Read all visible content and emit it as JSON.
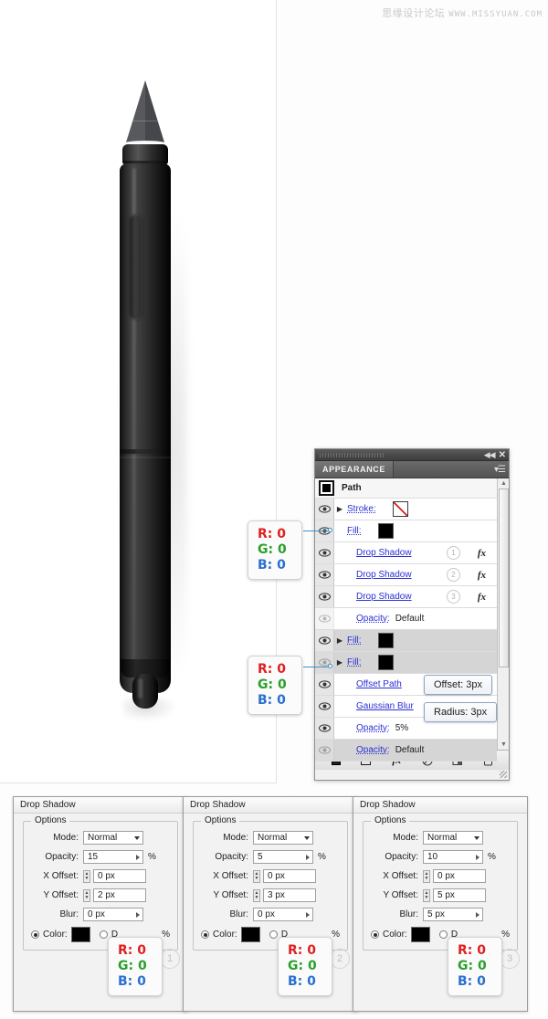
{
  "watermark": {
    "cn": "思缘设计论坛",
    "url": "WWW.MISSYUAN.COM"
  },
  "appearance_panel": {
    "tab_label": "APPEARANCE",
    "collapse_icon": "◀◀",
    "close_icon": "✕",
    "menu_icon": "panel-menu-icon",
    "object_title": "Path",
    "rows": [
      {
        "id": "stroke",
        "label": "Stroke:",
        "value": "",
        "swatch": "none",
        "arrow": true,
        "indent": false,
        "shaded": false,
        "eye": "on",
        "badge": "",
        "fx": false
      },
      {
        "id": "fill-1",
        "label": "Fill:",
        "value": "",
        "swatch": "black",
        "arrow": false,
        "indent": false,
        "shaded": false,
        "eye": "on",
        "badge": "",
        "fx": false
      },
      {
        "id": "drop-shadow-1",
        "label": "Drop Shadow",
        "value": "",
        "swatch": "",
        "arrow": false,
        "indent": true,
        "shaded": false,
        "eye": "on",
        "badge": "1",
        "fx": true
      },
      {
        "id": "drop-shadow-2",
        "label": "Drop Shadow",
        "value": "",
        "swatch": "",
        "arrow": false,
        "indent": true,
        "shaded": false,
        "eye": "on",
        "badge": "2",
        "fx": true
      },
      {
        "id": "drop-shadow-3",
        "label": "Drop Shadow",
        "value": "",
        "swatch": "",
        "arrow": false,
        "indent": true,
        "shaded": false,
        "eye": "on",
        "badge": "3",
        "fx": true
      },
      {
        "id": "opacity-1",
        "label": "Opacity:",
        "value": "Default",
        "swatch": "",
        "arrow": false,
        "indent": true,
        "shaded": false,
        "eye": "dim",
        "badge": "",
        "fx": false
      },
      {
        "id": "fill-2",
        "label": "Fill:",
        "value": "",
        "swatch": "black",
        "arrow": true,
        "indent": false,
        "shaded": true,
        "eye": "on",
        "badge": "",
        "fx": false
      },
      {
        "id": "fill-3",
        "label": "Fill:",
        "value": "",
        "swatch": "black",
        "arrow": true,
        "indent": false,
        "shaded": true,
        "eye": "dim",
        "badge": "",
        "fx": false
      },
      {
        "id": "offset-path",
        "label": "Offset Path",
        "value": "",
        "swatch": "",
        "arrow": false,
        "indent": true,
        "shaded": false,
        "eye": "on",
        "badge": "",
        "fx": false
      },
      {
        "id": "gaussian-blur",
        "label": "Gaussian Blur",
        "value": "",
        "swatch": "",
        "arrow": false,
        "indent": true,
        "shaded": false,
        "eye": "on",
        "badge": "",
        "fx": false
      },
      {
        "id": "opacity-2",
        "label": "Opacity:",
        "value": "5%",
        "swatch": "",
        "arrow": false,
        "indent": true,
        "shaded": false,
        "eye": "on",
        "badge": "",
        "fx": false
      },
      {
        "id": "opacity-3",
        "label": "Opacity:",
        "value": "Default",
        "swatch": "",
        "arrow": false,
        "indent": false,
        "shaded": true,
        "eye": "dim",
        "badge": "",
        "fx": false
      }
    ],
    "footer_buttons": [
      {
        "id": "add-new-stroke",
        "icon": "filled-square-icon"
      },
      {
        "id": "add-new-fill",
        "icon": "outline-square-icon"
      },
      {
        "id": "add-new-effect",
        "icon": "fx-icon"
      },
      {
        "id": "clear-appearance",
        "icon": "no-symbol-icon"
      },
      {
        "id": "duplicate-item",
        "icon": "duplicate-icon"
      },
      {
        "id": "delete-item",
        "icon": "trash-icon"
      }
    ],
    "scrollbar": {
      "up_arrow": "▲",
      "down_arrow": "▼"
    }
  },
  "chips": [
    {
      "id": "offset-chip",
      "label": "Offset: 3px"
    },
    {
      "id": "radius-chip",
      "label": "Radius: 3px"
    }
  ],
  "rgb_callouts": [
    {
      "id": "rgb-stroke-fill",
      "r": "R: 0",
      "g": "G: 0",
      "b": "B: 0"
    },
    {
      "id": "rgb-fill-second",
      "r": "R: 0",
      "g": "G: 0",
      "b": "B: 0"
    },
    {
      "id": "rgb-dialog-1",
      "r": "R: 0",
      "g": "G: 0",
      "b": "B: 0"
    },
    {
      "id": "rgb-dialog-2",
      "r": "R: 0",
      "g": "G: 0",
      "b": "B: 0"
    },
    {
      "id": "rgb-dialog-3",
      "r": "R: 0",
      "g": "G: 0",
      "b": "B: 0"
    }
  ],
  "drop_shadow_dialogs": [
    {
      "id": "drop-shadow-dialog-1",
      "title": "Drop Shadow",
      "options_legend": "Options",
      "badge": "1",
      "fields": {
        "mode_label": "Mode:",
        "mode_value": "Normal",
        "opacity_label": "Opacity:",
        "opacity_value": "15",
        "opacity_unit": "%",
        "x_offset_label": "X Offset:",
        "x_offset_value": "0 px",
        "y_offset_label": "Y Offset:",
        "y_offset_value": "2 px",
        "blur_label": "Blur:",
        "blur_value": "0 px",
        "color_label": "Color:",
        "darkness_label": "D",
        "darkness_unit": "%"
      }
    },
    {
      "id": "drop-shadow-dialog-2",
      "title": "Drop Shadow",
      "options_legend": "Options",
      "badge": "2",
      "fields": {
        "mode_label": "Mode:",
        "mode_value": "Normal",
        "opacity_label": "Opacity:",
        "opacity_value": "5",
        "opacity_unit": "%",
        "x_offset_label": "X Offset:",
        "x_offset_value": "0 px",
        "y_offset_label": "Y Offset:",
        "y_offset_value": "3 px",
        "blur_label": "Blur:",
        "blur_value": "0 px",
        "color_label": "Color:",
        "darkness_label": "D",
        "darkness_unit": "%"
      }
    },
    {
      "id": "drop-shadow-dialog-3",
      "title": "Drop Shadow",
      "options_legend": "Options",
      "badge": "3",
      "fields": {
        "mode_label": "Mode:",
        "mode_value": "Normal",
        "opacity_label": "Opacity:",
        "opacity_value": "10",
        "opacity_unit": "%",
        "x_offset_label": "X Offset:",
        "x_offset_value": "0 px",
        "y_offset_label": "Y Offset:",
        "y_offset_value": "5 px",
        "blur_label": "Blur:",
        "blur_value": "5 px",
        "color_label": "Color:",
        "darkness_label": "D",
        "darkness_unit": "%"
      }
    }
  ],
  "artwork": {
    "name": "stylus-pen-illustration"
  }
}
